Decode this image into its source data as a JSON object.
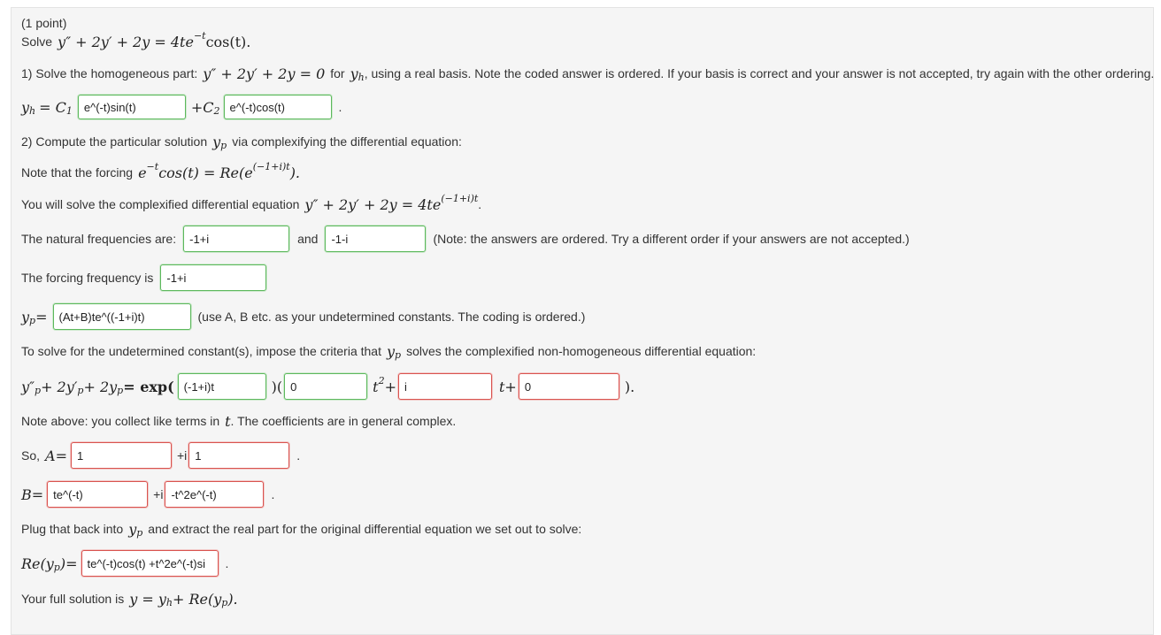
{
  "header": {
    "points": "(1 point)"
  },
  "problem": {
    "solve_prefix": "Solve",
    "equation": "y″ + 2y′ + 2y = 4te",
    "exp": "−t",
    "tail": " cos(t)."
  },
  "part1": {
    "text_a": "1) Solve the homogeneous part:",
    "eq": "y″ + 2y′ + 2y = 0",
    "text_b": "for",
    "yh": "y",
    "yh_sub": "h",
    "text_c": ", using a real basis. Note the coded answer is ordered. If your basis is correct and your answer is not accepted, try again with the other ordering.",
    "lhs": "= C",
    "c1sub": "1",
    "c2": "+C",
    "c2sub": "2",
    "answer1": "e^(-t)sin(t)",
    "answer2": "e^(-t)cos(t)",
    "period": "."
  },
  "part2": {
    "text_a": "2) Compute the particular solution",
    "yp": "y",
    "yp_sub": "p",
    "text_b": "via complexifying the differential equation:",
    "note_a": "Note that the forcing",
    "note_eq": "e",
    "note_exp": "−t",
    "note_eq2": " cos(t) = Re(e",
    "note_exp2": "(−1+i)t",
    "note_eq3": ").",
    "complex_a": "You will solve the complexified differential equation",
    "complex_eq": "y″ + 2y′ + 2y = 4te",
    "complex_exp": "(−1+i)t",
    "complex_end": "."
  },
  "natural": {
    "label": "The natural frequencies are:",
    "answer1": "-1+i",
    "and": "and",
    "answer2": "-1-i",
    "note": "(Note: the answers are ordered. Try a different order if your answers are not accepted.)"
  },
  "forcing": {
    "label": "The forcing frequency is",
    "answer": "-1+i"
  },
  "yp_row": {
    "lhs": "y",
    "sub": "p",
    "eq": " =",
    "answer": "(At+B)te^((-1+i)t)",
    "note": "(use A, B etc. as your undetermined constants. The coding is ordered.)"
  },
  "criteria": {
    "text_a": "To solve for the undetermined constant(s), impose the criteria that",
    "yp": "y",
    "yp_sub": "p",
    "text_b": "solves the complexified non-homogeneous differential equation:"
  },
  "eq_row": {
    "lhs": "y″",
    "lhs_sub": "p",
    "mid1": " + 2y′",
    "mid1_sub": "p",
    "mid2": " + 2y",
    "mid2_sub": "p",
    "mid3": " = exp(",
    "answer_exp": "(-1+i)t",
    "paren": ")(",
    "answer_c0": "0",
    "t2": "t",
    "t2_sup": "2",
    "plus1": "+",
    "answer_c1": "i",
    "t1": "t+",
    "answer_c2": "0",
    "close": ")."
  },
  "like_terms": {
    "text_a": "Note above: you collect like terms in",
    "t": "t",
    "text_b": ". The coefficients are in general complex."
  },
  "A_row": {
    "label": "So,",
    "A": "A",
    "eq": " =",
    "answer_re": "1",
    "plus_i": "+i",
    "answer_im": "1",
    "period": "."
  },
  "B_row": {
    "B": "B",
    "eq": " =",
    "answer_re": "te^(-t)",
    "plus_i": "+i",
    "answer_im": "-t^2e^(-t)",
    "period": "."
  },
  "plug": {
    "text_a": "Plug that back into",
    "yp": "y",
    "yp_sub": "p",
    "text_b": "and extract the real part for the original differential equation we set out to solve:"
  },
  "re_row": {
    "lhs": "Re(y",
    "lhs_sub": "p",
    "lhs_end": ")",
    "eq": " =",
    "answer": "te^(-t)cos(t) +t^2e^(-t)si",
    "period": "."
  },
  "full": {
    "text_a": "Your full solution is",
    "eq": "y = y",
    "sub_h": "h",
    "eq2": " + Re(y",
    "sub_p": "p",
    "eq3": ")."
  }
}
